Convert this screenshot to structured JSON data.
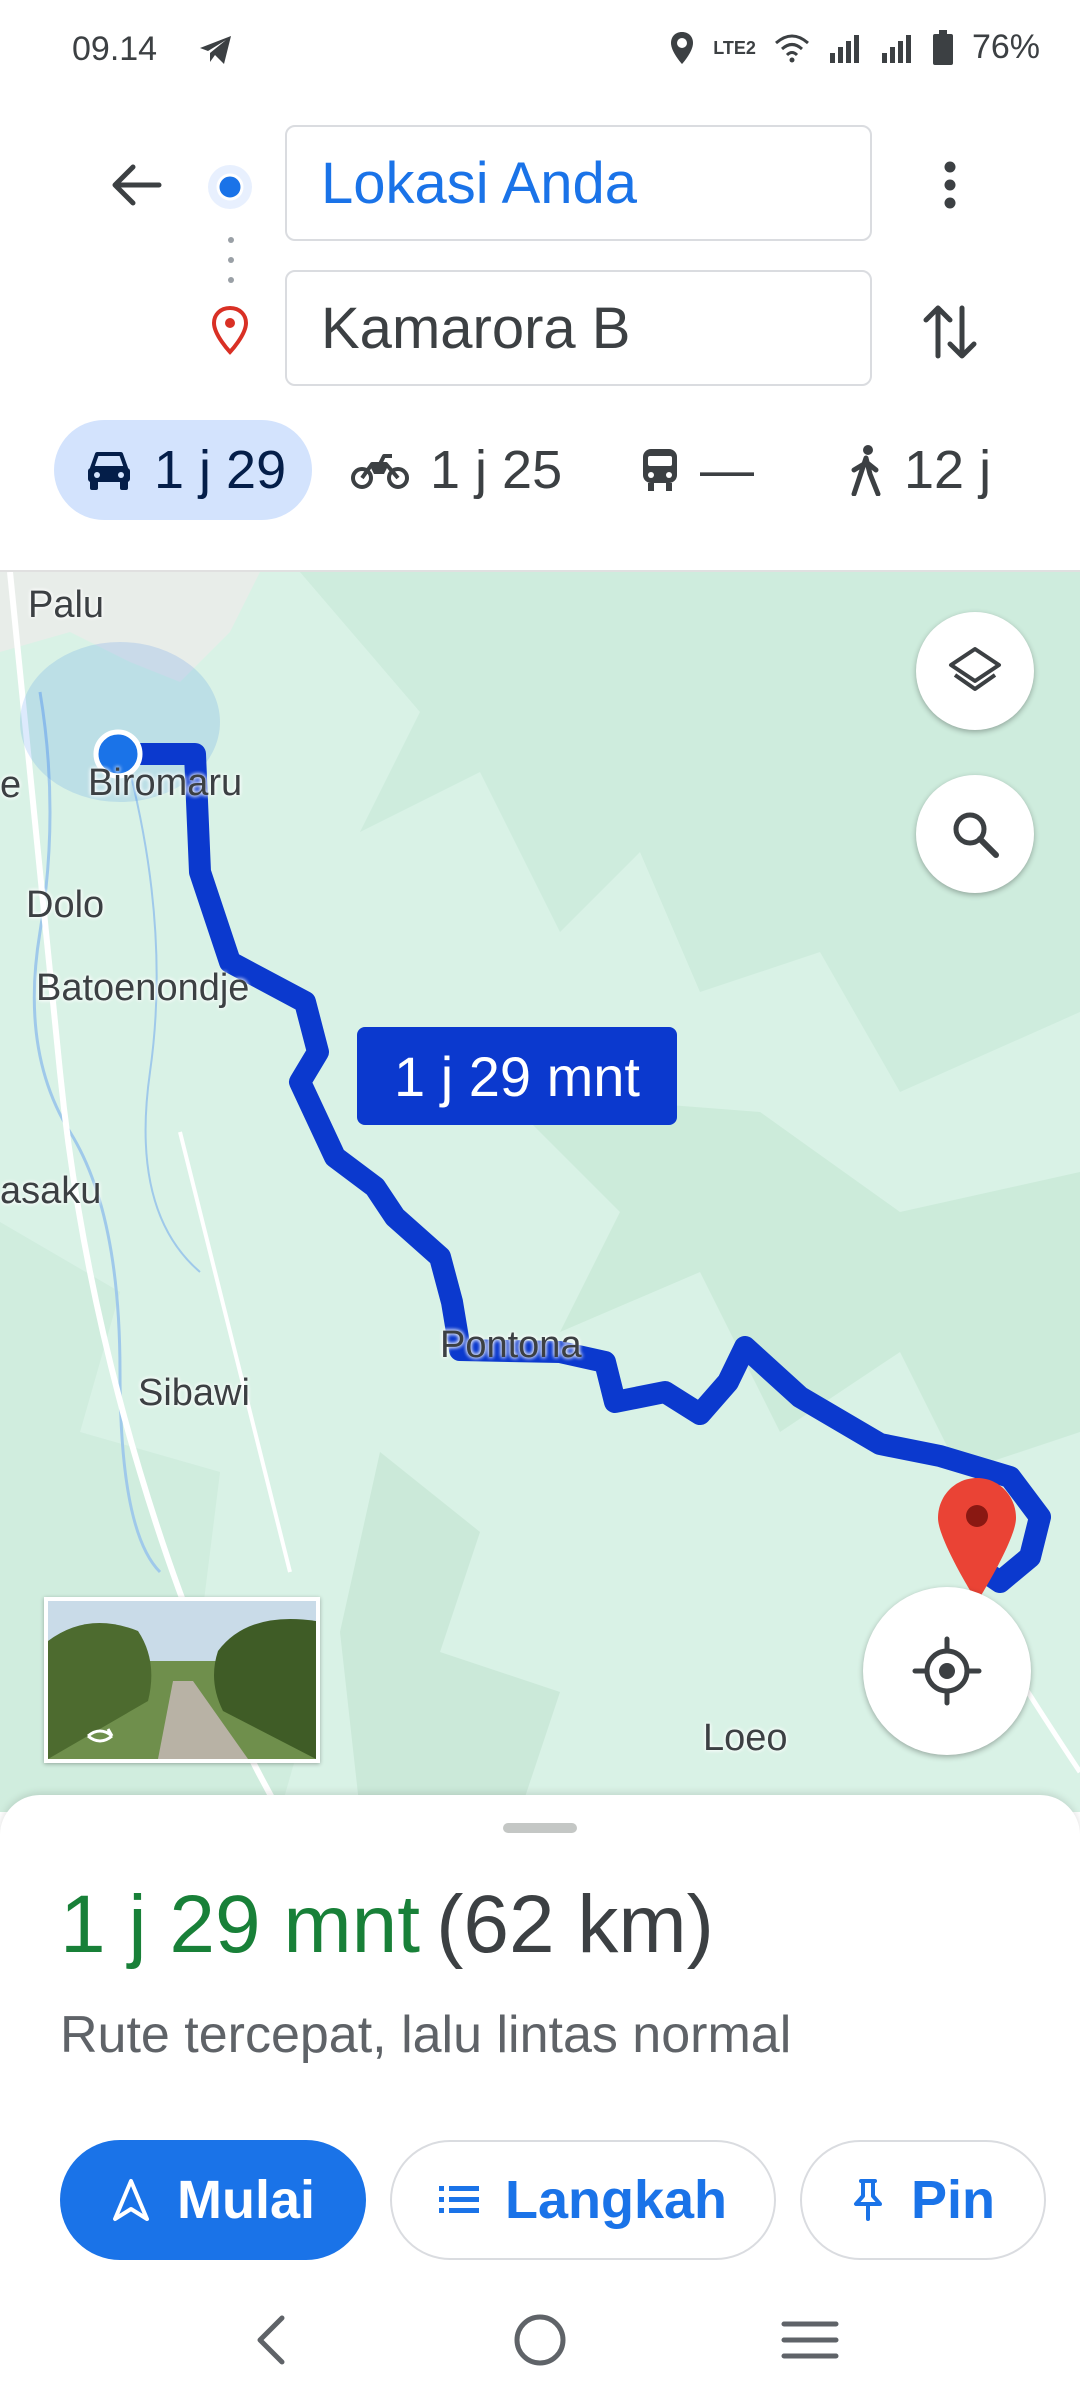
{
  "status": {
    "time": "09.14",
    "battery": "76%",
    "network_label": "LTE2"
  },
  "search": {
    "origin": "Lokasi Anda",
    "destination": "Kamarora B"
  },
  "modes": [
    {
      "name": "car",
      "label": "1 j 29",
      "selected": true
    },
    {
      "name": "motorcycle",
      "label": "1 j 25"
    },
    {
      "name": "transit",
      "label": "—"
    },
    {
      "name": "walk",
      "label": "12 j"
    }
  ],
  "map": {
    "route_duration_label": "1 j 29 mnt",
    "labels": {
      "palu": "Palu",
      "e": "e",
      "biromaru": "Biromaru",
      "dolo": "Dolo",
      "batoenondje": "Batoenondje",
      "asaku": "asaku",
      "sibawi": "Sibawi",
      "pontona": "Pontona",
      "loeo": "Loeo"
    },
    "colors": {
      "route": "#0b39ce",
      "map_bg": "#d9f2e6",
      "destination_pin": "#d93025",
      "origin_dot": "#1a73e8"
    }
  },
  "sheet": {
    "duration": "1 j 29 mnt",
    "distance": "(62 km)",
    "description": "Rute tercepat, lalu lintas normal",
    "buttons": {
      "start": "Mulai",
      "steps": "Langkah",
      "pin": "Pin"
    }
  },
  "icons": [
    "back-arrow-icon",
    "more-vert-icon",
    "swap-icon",
    "car-icon",
    "motorcycle-icon",
    "transit-icon",
    "walk-icon",
    "layers-icon",
    "search-icon",
    "locate-icon",
    "navigation-icon",
    "list-icon",
    "pin-icon"
  ]
}
